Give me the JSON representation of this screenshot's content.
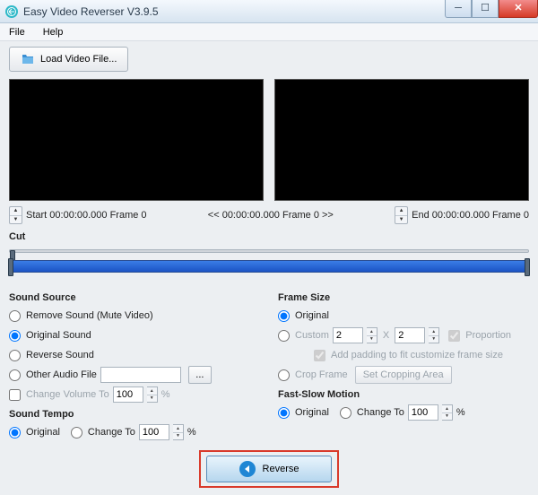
{
  "window": {
    "title": "Easy Video Reverser V3.9.5"
  },
  "menu": {
    "file": "File",
    "help": "Help"
  },
  "toolbar": {
    "load_label": "Load Video File..."
  },
  "time": {
    "start_label": "Start 00:00:00.000 Frame 0",
    "mid_label": "<< 00:00:00.000  Frame 0 >>",
    "end_label": "End 00:00:00.000  Frame 0"
  },
  "cut": {
    "label": "Cut"
  },
  "sound_source": {
    "title": "Sound Source",
    "remove": "Remove Sound (Mute Video)",
    "original": "Original Sound",
    "reverse": "Reverse Sound",
    "other": "Other Audio File",
    "browse": "...",
    "change_volume": "Change Volume To",
    "volume_value": "100",
    "percent": "%"
  },
  "sound_tempo": {
    "title": "Sound Tempo",
    "original": "Original",
    "change_to": "Change To",
    "value": "100",
    "percent": "%"
  },
  "frame_size": {
    "title": "Frame Size",
    "original": "Original",
    "custom": "Custom",
    "w": "2",
    "by": "X",
    "h": "2",
    "proportion": "Proportion",
    "padding": "Add padding to fit customize frame size",
    "crop": "Crop Frame",
    "set_crop": "Set Cropping Area"
  },
  "fast_slow": {
    "title": "Fast-Slow Motion",
    "original": "Original",
    "change_to": "Change To",
    "value": "100",
    "percent": "%"
  },
  "reverse": {
    "label": "Reverse"
  }
}
